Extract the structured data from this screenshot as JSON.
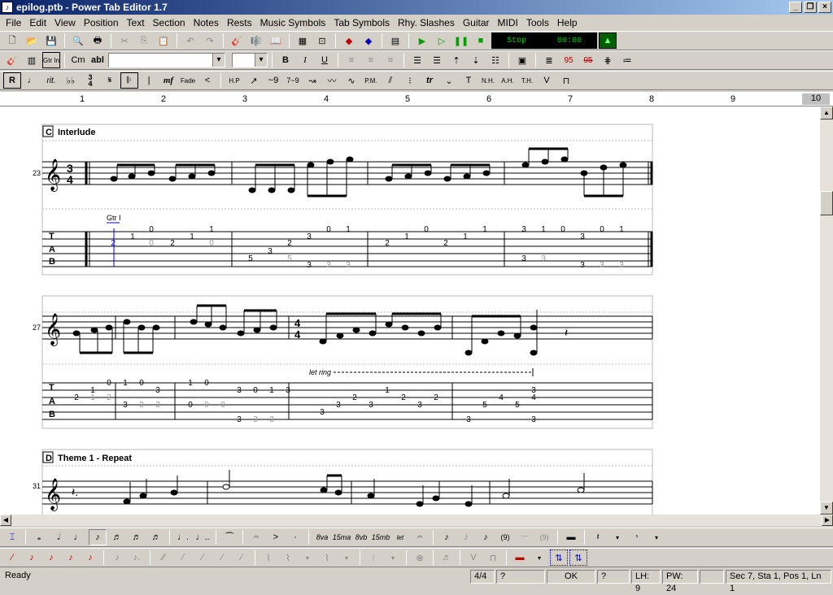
{
  "window": {
    "title": "epilog.ptb - Power Tab Editor 1.7"
  },
  "menu": [
    "File",
    "Edit",
    "View",
    "Position",
    "Text",
    "Section",
    "Notes",
    "Rests",
    "Music Symbols",
    "Tab Symbols",
    "Rhy. Slashes",
    "Guitar",
    "MIDI",
    "Tools",
    "Help"
  ],
  "toolbar": {
    "transport_status": "Stop",
    "transport_time": "00:00",
    "chord_label": "Cm",
    "text_label": "abl",
    "guitar_in_label": "Gtr In"
  },
  "ruler": {
    "marks": [
      "1",
      "2",
      "3",
      "4",
      "5",
      "6",
      "7",
      "8",
      "9",
      "10"
    ]
  },
  "sections": [
    {
      "letter": "C",
      "title": "Interlude",
      "measure_start": "23",
      "time_sig_top": "3",
      "time_sig_bottom": "4",
      "guitar_label": "Gtr I"
    },
    {
      "letter": "",
      "title": "",
      "measure_start": "27",
      "time_sig_top": "4",
      "time_sig_bottom": "4",
      "let_ring": "let ring"
    },
    {
      "letter": "D",
      "title": "Theme 1 - Repeat",
      "measure_start": "31"
    }
  ],
  "tab_letters": [
    "T",
    "A",
    "B"
  ],
  "status": {
    "ready": "Ready",
    "time_sig": "4/4",
    "unknown1": "?",
    "ok": "OK",
    "unknown2": "?",
    "lh": "LH: 9",
    "pw": "PW: 24",
    "position": "Sec 7, Sta 1, Pos 1, Ln 1"
  },
  "colors": {
    "titlebar_start": "#0a246a",
    "titlebar_end": "#a6caf0",
    "play_green": "#00a000",
    "cursor_blue": "#0000ff",
    "red_icon": "#c00000"
  }
}
